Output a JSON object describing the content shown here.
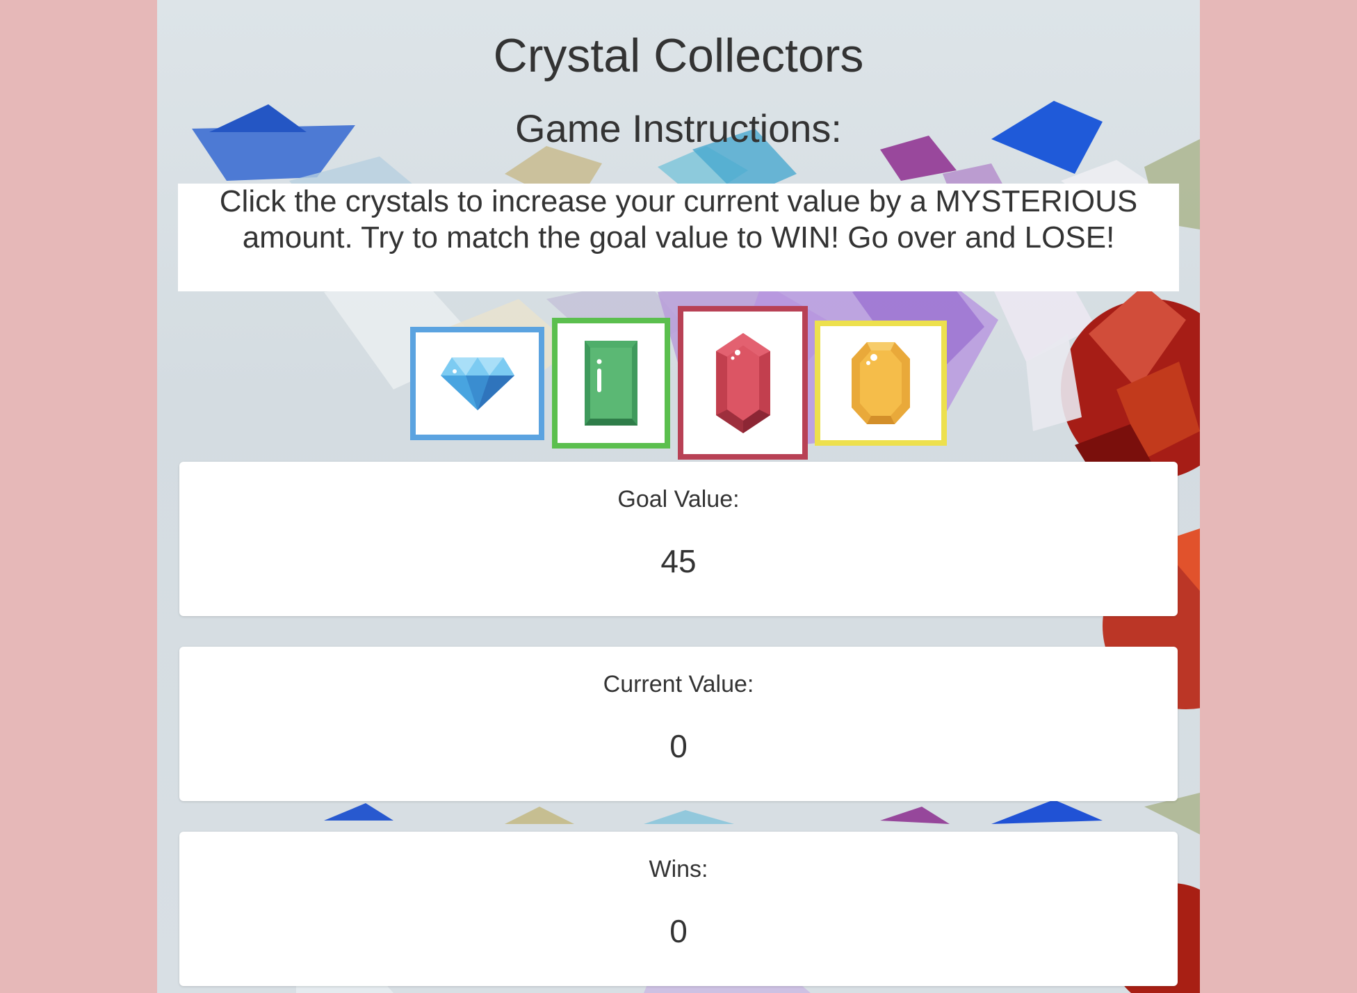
{
  "header": {
    "title": "Crystal Collectors",
    "subtitle": "Game Instructions:"
  },
  "instructions": {
    "text": "Click the crystals to increase your current value by a MYSTERIOUS amount. Try to match the goal value to WIN! Go over and LOSE!"
  },
  "crystals": [
    {
      "name": "blue-diamond",
      "border_color": "#5ba3e0"
    },
    {
      "name": "green-emerald",
      "border_color": "#5bbf4e"
    },
    {
      "name": "red-ruby",
      "border_color": "#b84155"
    },
    {
      "name": "yellow-topaz",
      "border_color": "#ede04d"
    }
  ],
  "panels": {
    "goal": {
      "label": "Goal Value:",
      "value": "45"
    },
    "current": {
      "label": "Current Value:",
      "value": "0"
    },
    "wins": {
      "label": "Wins:",
      "value": "0"
    }
  },
  "colors": {
    "page_background": "#e6b8b8",
    "panel_background": "#ffffff",
    "text": "#333333"
  }
}
